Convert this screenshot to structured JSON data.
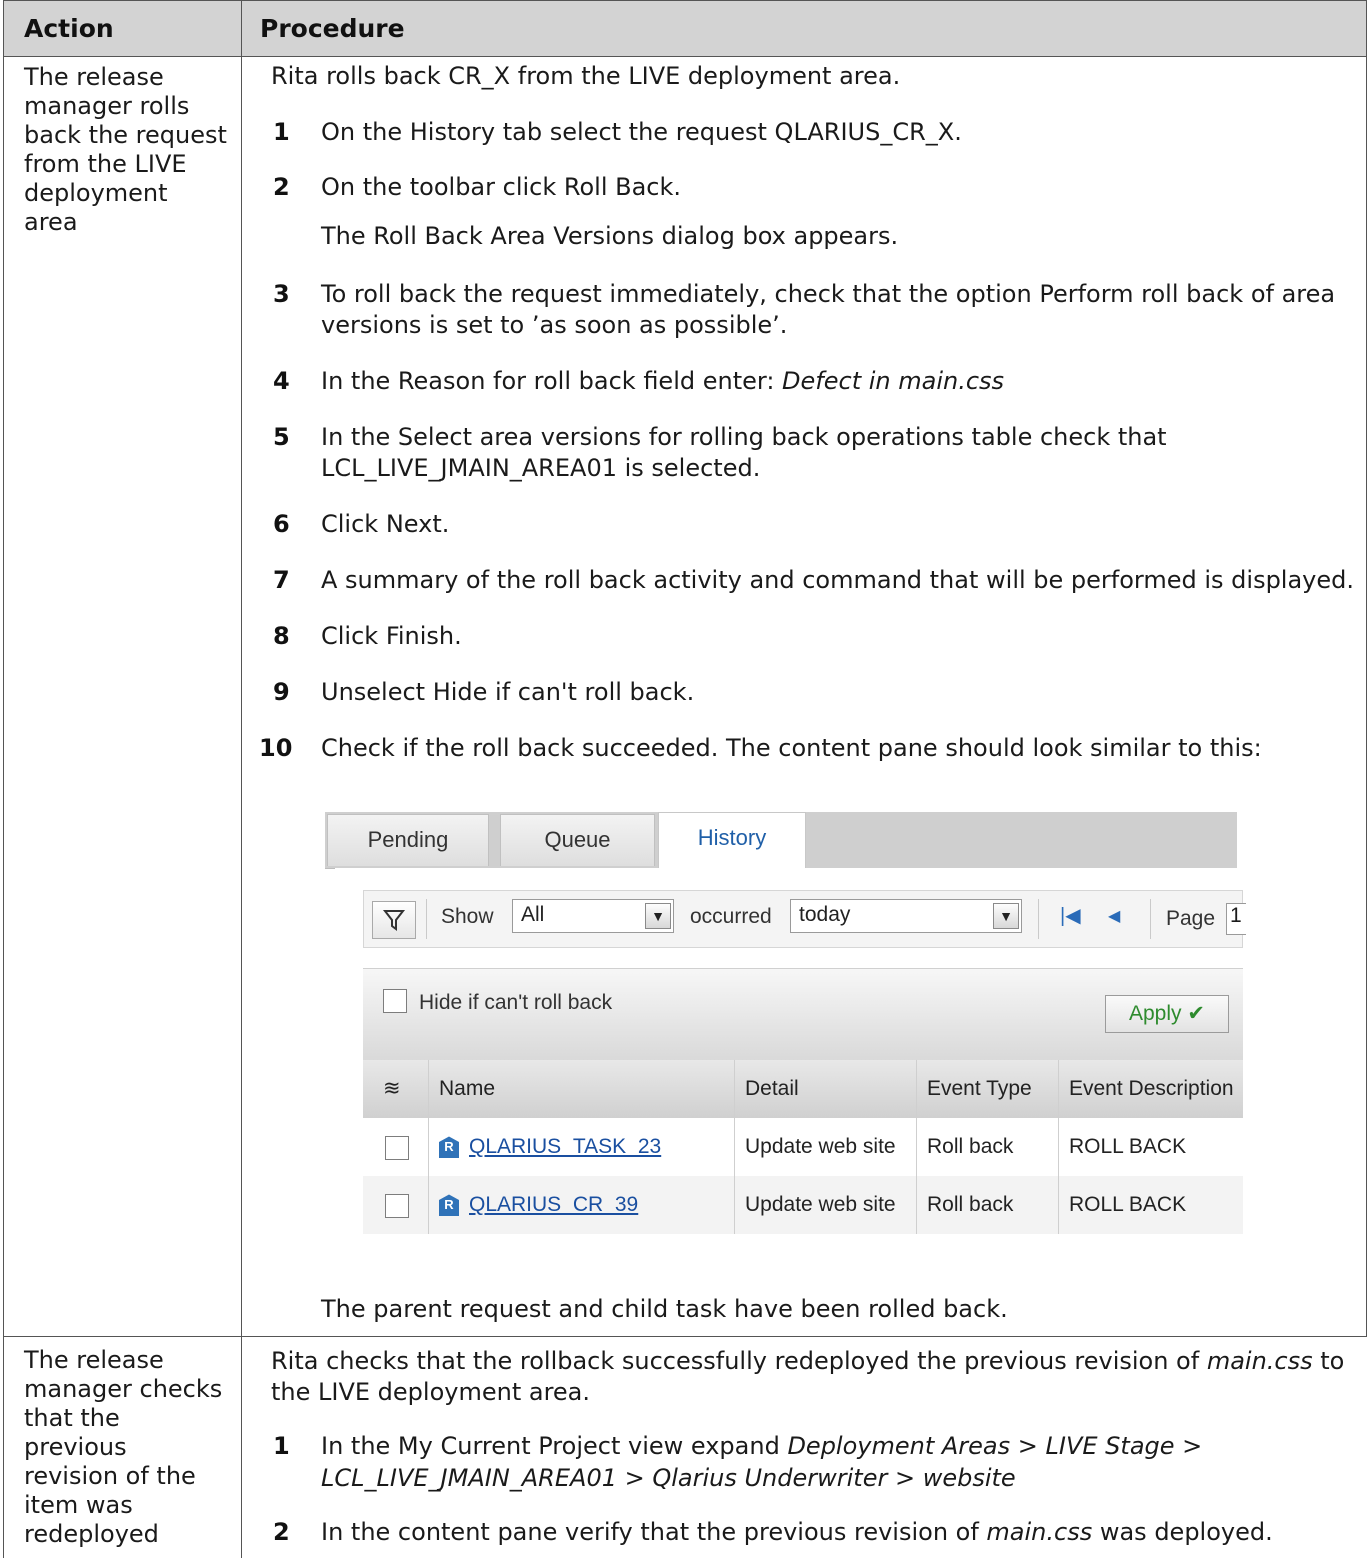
{
  "table": {
    "headers": [
      "Action",
      "Procedure"
    ]
  },
  "row1": {
    "action_lines": [
      "The release",
      "manager rolls",
      "back the request",
      "from the LIVE",
      "deployment",
      "area"
    ],
    "intro": "Rita rolls back CR_X from the LIVE deployment area.",
    "steps": [
      {
        "num": "1",
        "lines": [
          "On the History tab select the request QLARIUS_CR_X."
        ]
      },
      {
        "num": "2",
        "lines": [
          "On the toolbar click Roll Back."
        ]
      },
      {
        "num": "",
        "lines": [
          "The Roll Back Area Versions dialog box appears."
        ]
      },
      {
        "num": "3",
        "lines": [
          "To roll back the request immediately, check that the option Perform roll back of area",
          "versions is set to ’as soon as possible’."
        ]
      },
      {
        "num": "4",
        "text_plain": "In the Reason for roll back field enter: ",
        "text_italic": "Defect in main.css"
      },
      {
        "num": "5",
        "lines": [
          "In the Select area versions for rolling back operations table check that",
          "LCL_LIVE_JMAIN_AREA01 is selected."
        ]
      },
      {
        "num": "6",
        "lines": [
          "Click Next."
        ]
      },
      {
        "num": "7",
        "lines": [
          "A summary of the roll back activity and command that will be performed is displayed."
        ]
      },
      {
        "num": "8",
        "lines": [
          "Click Finish."
        ]
      },
      {
        "num": "9",
        "lines": [
          "Unselect Hide if can't roll back."
        ]
      },
      {
        "num": "10",
        "lines": [
          "Check if the roll back succeeded. The content pane should look similar to this:"
        ]
      }
    ],
    "closing": "The parent request and child task have been rolled back."
  },
  "screenshot": {
    "tabs": [
      "Pending",
      "Queue",
      "History"
    ],
    "active_tab": "History",
    "filter": {
      "show_label": "Show",
      "show_value": "All",
      "occurred_label": "occurred",
      "occurred_value": "today",
      "page_label": "Page",
      "page_value": "1"
    },
    "hide_label": "Hide if can't roll back",
    "apply_label": "Apply",
    "columns": [
      "Name",
      "Detail",
      "Event Type",
      "Event Description"
    ],
    "rows": [
      {
        "name": "QLARIUS_TASK_23",
        "detail": "Update web site",
        "event_type": "Roll back",
        "event_desc": "ROLL BACK"
      },
      {
        "name": "QLARIUS_CR_39",
        "detail": "Update web site",
        "event_type": "Roll back",
        "event_desc": "ROLL BACK"
      }
    ]
  },
  "row2": {
    "action_lines": [
      "The release",
      "manager checks",
      "that the",
      "previous",
      "revision of the",
      "item was",
      "redeployed"
    ],
    "intro_a": "Rita checks that the rollback successfully redeployed the previous revision of ",
    "intro_a_italic": "main.css",
    "intro_a_end": " to",
    "intro_b": "the LIVE deployment area.",
    "step1_plain": "In the My Current Project view expand ",
    "step1_italic_a": "Deployment Areas > LIVE Stage >",
    "step1_italic_b": "LCL_LIVE_JMAIN_AREA01 > Qlarius Underwriter > website",
    "step2_plain_a": "In the content pane verify that the previous revision of ",
    "step2_italic": "main.css",
    "step2_plain_b": " was deployed.",
    "step_nums": [
      "1",
      "2"
    ]
  }
}
